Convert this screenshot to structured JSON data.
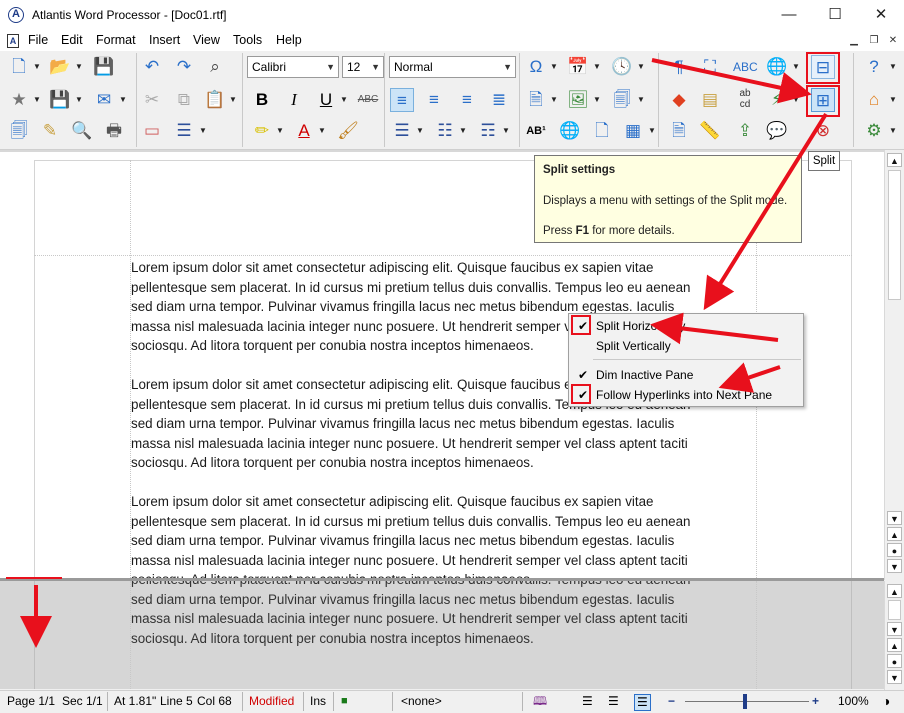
{
  "window": {
    "title": "Atlantis Word Processor - [Doc01.rtf]",
    "minimize_glyph": "—",
    "maximize_glyph": "☐",
    "close_glyph": "✕"
  },
  "menu": {
    "items": [
      "File",
      "Edit",
      "Format",
      "Insert",
      "View",
      "Tools",
      "Help"
    ]
  },
  "toolbar": {
    "font_name": "Calibri",
    "font_size": "12",
    "style_name": "Normal"
  },
  "tooltip": {
    "title": "Split settings",
    "description": "Displays a menu with settings of the Split mode.",
    "help_prefix": "Press ",
    "help_key": "F1",
    "help_suffix": " for more details."
  },
  "split_button_tooltip": "Split",
  "split_menu": {
    "items": [
      {
        "label": "Split Horizontally",
        "checked": true
      },
      {
        "label": "Split Vertically",
        "checked": false
      },
      {
        "label": "Dim Inactive Pane",
        "checked": true
      },
      {
        "label": "Follow Hyperlinks into Next Pane",
        "checked": true
      }
    ]
  },
  "document": {
    "paragraph_lines": [
      "Lorem ipsum dolor sit amet consectetur adipiscing elit. Quisque faucibus ex sapien vitae",
      "pellentesque sem placerat. In id cursus mi pretium tellus duis convallis. Tempus leo eu aenean",
      "sed diam urna tempor. Pulvinar vivamus fringilla lacus nec metus bibendum egestas. Iaculis",
      "massa nisl malesuada lacinia integer nunc posuere. Ut hendrerit semper vel class aptent taciti",
      "sociosqu. Ad litora torquent per conubia nostra inceptos himenaeos."
    ],
    "lower_pane_lines": [
      "pellentesque sem placerat. In id cursus mi pretium tellus duis convallis. Tempus leo eu aenean",
      "sed diam urna tempor. Pulvinar vivamus fringilla lacus nec metus bibendum egestas. Iaculis",
      "massa nisl malesuada lacinia integer nunc posuere. Ut hendrerit semper vel class aptent taciti",
      "sociosqu. Ad litora torquent per conubia nostra inceptos himenaeos."
    ]
  },
  "status": {
    "page": "Page 1/1",
    "section": "Sec 1/1",
    "position": "At 1.81\"",
    "line": "Line 5",
    "col": "Col 68",
    "modified": "Modified",
    "insert_mode": "Ins",
    "style": "<none>",
    "zoom": "100%"
  },
  "colors": {
    "annotation_red": "#e8101c",
    "tooltip_bg": "#ffffe1",
    "modified_text": "#d00000",
    "inactive_pane": "#d6d6d6"
  }
}
